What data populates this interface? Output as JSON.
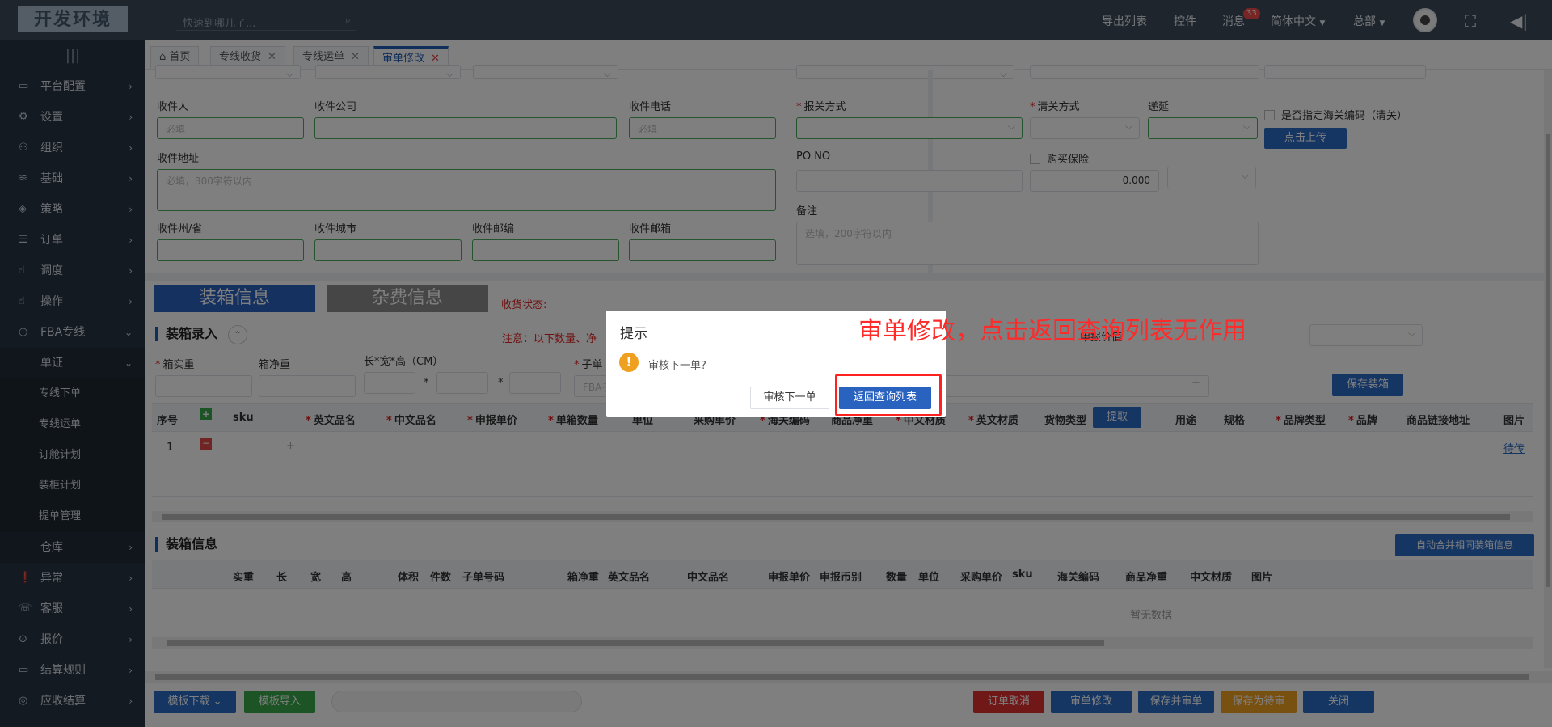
{
  "app": {
    "logo": "开发环境",
    "search_placeholder": "快速到哪儿了..."
  },
  "topnav": {
    "export": "导出列表",
    "widgets": "控件",
    "messages": "消息",
    "message_count": "33",
    "language": "简体中文",
    "hq": "总部"
  },
  "sidebar": {
    "items": [
      {
        "label": "平台配置"
      },
      {
        "label": "设置"
      },
      {
        "label": "组织"
      },
      {
        "label": "基础"
      },
      {
        "label": "策略"
      },
      {
        "label": "订单"
      },
      {
        "label": "调度"
      },
      {
        "label": "操作"
      },
      {
        "label": "FBA专线"
      },
      {
        "label": "单证"
      }
    ],
    "subitems": [
      {
        "label": "专线下单"
      },
      {
        "label": "专线运单"
      },
      {
        "label": "订舱计划"
      },
      {
        "label": "装柜计划"
      },
      {
        "label": "提单管理"
      }
    ],
    "items2": [
      {
        "label": "仓库"
      },
      {
        "label": "异常"
      },
      {
        "label": "客服"
      },
      {
        "label": "报价"
      },
      {
        "label": "结算规则"
      },
      {
        "label": "应收结算"
      }
    ]
  },
  "tabs": [
    {
      "label": "首页"
    },
    {
      "label": "专线收货"
    },
    {
      "label": "专线运单"
    },
    {
      "label": "审单修改"
    }
  ],
  "form": {
    "receiver": "收件人",
    "receiver_company": "收件公司",
    "receiver_phone": "收件电话",
    "required_ph": "必填",
    "address": "收件地址",
    "address_ph": "必填，300字符以内",
    "state": "收件州/省",
    "city": "收件城市",
    "zip": "收件邮编",
    "email": "收件邮箱",
    "declare_method": "报关方式",
    "clearance_method": "清关方式",
    "deferred": "递延",
    "hs_code_check": "是否指定海关编码（清关）",
    "upload_btn": "点击上传",
    "po_no": "PO NO",
    "insurance": "购买保险",
    "insurance_val": "0.000",
    "remark": "备注",
    "remark_ph": "选填，200字符以内"
  },
  "packing": {
    "tab_packing": "装箱信息",
    "tab_fees": "杂费信息",
    "receive_status": "收货状态:",
    "entry_title": "装箱录入",
    "notice": "注意：以下数量、净",
    "declare_value": "申报价值",
    "box_real_weight": "箱实重",
    "box_net_weight": "箱净重",
    "dims": "长*宽*高（CM）",
    "sub_order": "子单",
    "sub_order_ph": "FBA子",
    "save_btn": "保存装箱",
    "cols": [
      "序号",
      "sku",
      "英文品名",
      "中文品名",
      "申报单价",
      "单箱数量",
      "单位",
      "采购单价",
      "海关编码",
      "商品净重",
      "中文材质",
      "英文材质",
      "货物类型",
      "用途",
      "规格",
      "品牌类型",
      "品牌",
      "商品链接地址",
      "图片"
    ],
    "fetch_btn": "提取",
    "row_no": "1",
    "pending": "待传"
  },
  "boxinfo": {
    "title": "装箱信息",
    "merge_btn": "自动合并相同装箱信息",
    "cols": [
      "实重",
      "长",
      "宽",
      "高",
      "体积",
      "件数",
      "子单号码",
      "箱净重",
      "英文品名",
      "中文品名",
      "申报单价",
      "申报币别",
      "数量",
      "单位",
      "采购单价",
      "sku",
      "海关编码",
      "商品净重",
      "中文材质",
      "图片"
    ],
    "empty": "暂无数据"
  },
  "footer": {
    "template_download": "模板下载",
    "template_import": "模板导入",
    "cancel_order": "订单取消",
    "edit_order": "审单修改",
    "save_review": "保存并审单",
    "save_pending": "保存为待审",
    "close": "关闭"
  },
  "dialog": {
    "title": "提示",
    "message": "审核下一单?",
    "next_btn": "审核下一单",
    "back_btn": "返回查询列表"
  },
  "annotation": "审单修改，点击返回查询列表无作用"
}
